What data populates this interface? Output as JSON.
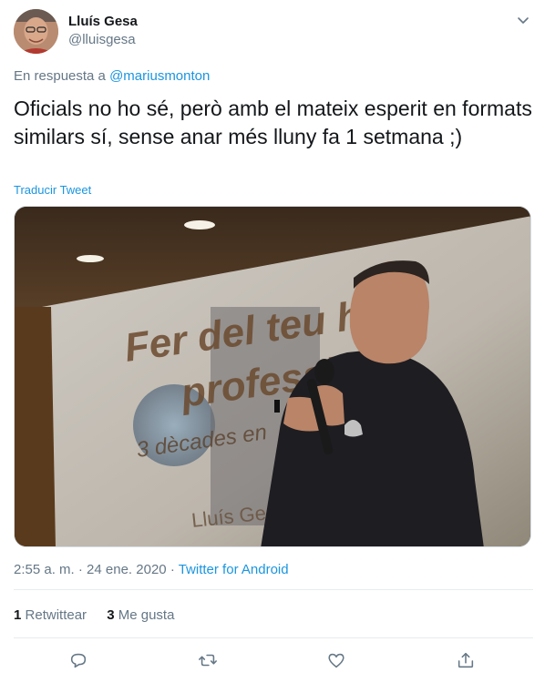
{
  "author": {
    "display_name": "Lluís Gesa",
    "handle": "@lluisgesa",
    "avatar_icon": "user-avatar-photo"
  },
  "reply": {
    "prefix": "En respuesta a",
    "mention": "@mariusmonton"
  },
  "tweet": {
    "text": "Oficials no ho sé, però amb el mateix esperit en formats similars sí, sense anar més lluny fa 1 setmana ;)",
    "translate_label": "Traducir Tweet"
  },
  "media": {
    "slide_line1": "Fer del teu h    y",
    "slide_line2": "professi",
    "slide_line3": "3 dècades en",
    "slide_footer": "Lluís Gesa B"
  },
  "meta": {
    "time": "2:55 a. m.",
    "separator": "·",
    "date": "24 ene. 2020",
    "source": "Twitter for Android"
  },
  "stats": {
    "retweets_count": "1",
    "retweets_label": "Retwittear",
    "likes_count": "3",
    "likes_label": "Me gusta"
  },
  "colors": {
    "accent": "#1b95e0",
    "secondary_text": "#657786",
    "divider": "#e6ecf0"
  }
}
